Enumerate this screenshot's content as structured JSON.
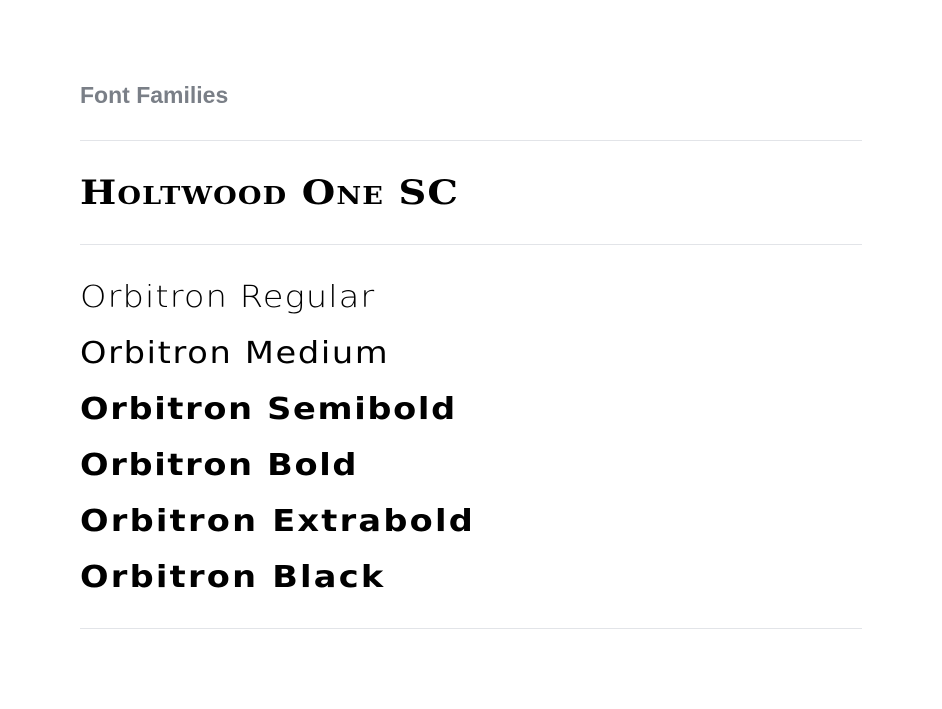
{
  "header": {
    "title": "Font Families"
  },
  "display_font": {
    "sample": "Holtwood One SC"
  },
  "weights": [
    "Orbitron Regular",
    "Orbitron Medium",
    "Orbitron Semibold",
    "Orbitron Bold",
    "Orbitron Extrabold",
    "Orbitron Black"
  ]
}
